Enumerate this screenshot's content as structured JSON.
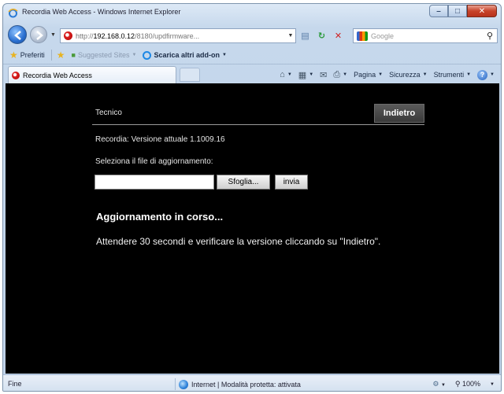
{
  "window": {
    "title": "Recordia Web Access - Windows Internet Explorer"
  },
  "address_bar": {
    "url_prefix": "http://",
    "url_host": "192.168.0.12",
    "url_rest": "/8180/updfirmware..."
  },
  "search": {
    "placeholder": "Google"
  },
  "favorites_bar": {
    "favorites_label": "Preferiti",
    "suggested_label": "Suggested Sites",
    "addons_label": "Scarica altri add-on"
  },
  "tab": {
    "title": "Recordia Web Access"
  },
  "command_bar": {
    "page_label": "Pagina",
    "security_label": "Sicurezza",
    "tools_label": "Strumenti"
  },
  "page": {
    "section_title": "Tecnico",
    "back_label": "Indietro",
    "version_text": "Recordia: Versione attuale 1.1009.16",
    "select_file_label": "Seleziona il file di aggiornamento:",
    "browse_label": "Sfoglia...",
    "send_label": "invia",
    "update_heading": "Aggiornamento in corso...",
    "update_message": "Attendere 30 secondi e verificare la versione cliccando su \"Indietro\"."
  },
  "status_bar": {
    "left_text": "Fine",
    "zone_text": "Internet | Modalità protetta: attivata",
    "zoom_text": "100%"
  },
  "colors": {
    "page_background": "#000000",
    "chrome_blue": "#c6d8ec",
    "close_red": "#c7432a"
  }
}
